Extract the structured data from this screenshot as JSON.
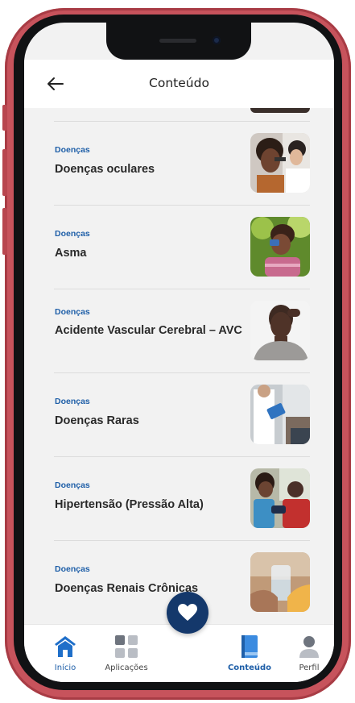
{
  "header": {
    "title": "Conteúdo"
  },
  "items": [
    {
      "category": "Doenças",
      "title": "Doenças oculares"
    },
    {
      "category": "Doenças",
      "title": "Asma"
    },
    {
      "category": "Doenças",
      "title": "Acidente Vascular Cerebral – AVC"
    },
    {
      "category": "Doenças",
      "title": "Doenças Raras"
    },
    {
      "category": "Doenças",
      "title": "Hipertensão (Pressão Alta)"
    },
    {
      "category": "Doenças",
      "title": "Doenças Renais Crônicas"
    }
  ],
  "nav": {
    "inicio": "Início",
    "aplicacoes": "Aplicações",
    "conteudo": "Conteúdo",
    "perfil": "Perfil",
    "active": "conteudo"
  },
  "colors": {
    "frame": "#c7535c",
    "accent": "#1f5fa8",
    "fab": "#14386b",
    "inactive": "#8a8f99"
  },
  "icons": {
    "back": "arrow-left-icon",
    "inicio": "home-icon",
    "aplicacoes": "grid-icon",
    "fab": "heart-icon",
    "conteudo": "book-icon",
    "perfil": "user-icon"
  }
}
